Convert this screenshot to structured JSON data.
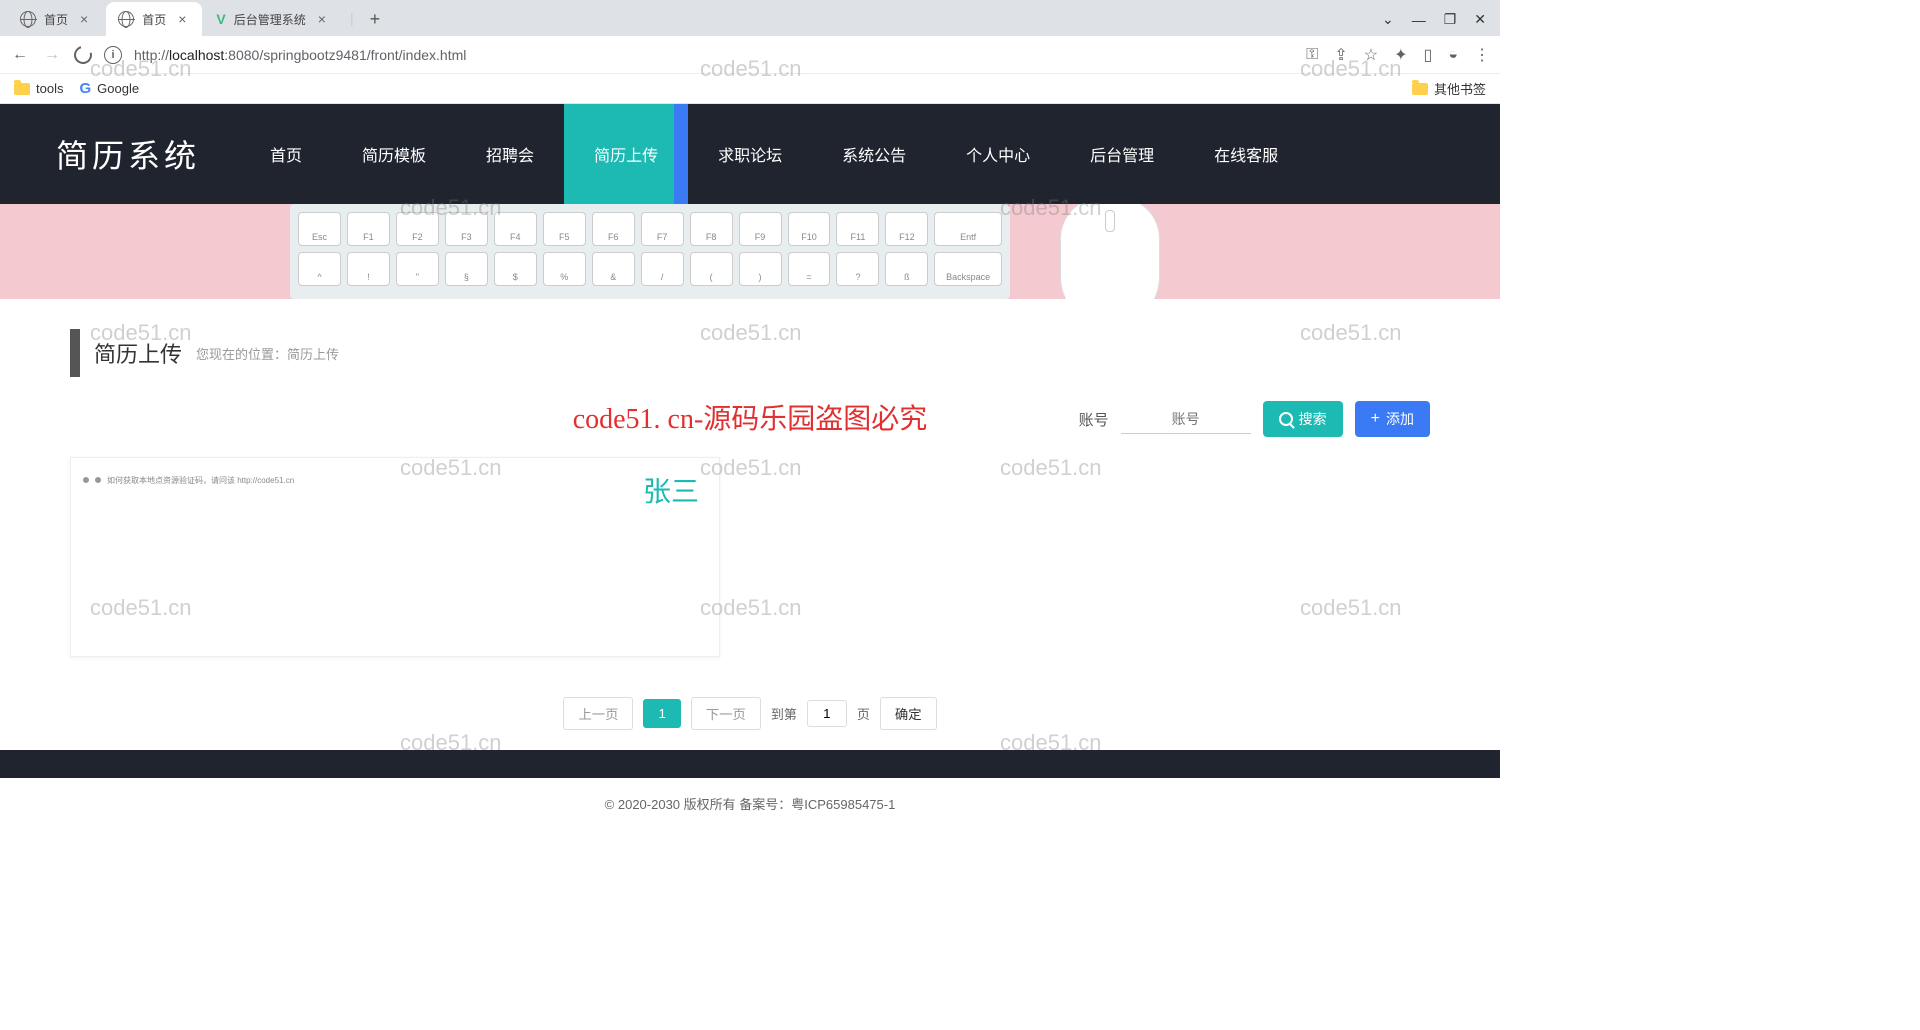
{
  "browser": {
    "tabs": [
      {
        "title": "首页",
        "icon": "globe"
      },
      {
        "title": "首页",
        "icon": "globe",
        "active": true
      },
      {
        "title": "后台管理系统",
        "icon": "vue"
      }
    ],
    "url_proto": "http://",
    "url_host": "localhost",
    "url_port": ":8080",
    "url_path": "/springbootz9481/front/index.html",
    "bookmarks": {
      "tools": "tools",
      "google": "Google",
      "other": "其他书签"
    }
  },
  "site": {
    "logo": "简历系统",
    "nav": [
      "首页",
      "简历模板",
      "招聘会",
      "简历上传",
      "求职论坛",
      "系统公告",
      "个人中心",
      "后台管理",
      "在线客服"
    ],
    "active_index": 3
  },
  "banner": {
    "keys_row1": [
      "Esc",
      "F1",
      "F2",
      "F3",
      "F4",
      "F5",
      "F6",
      "F7",
      "F8",
      "F9",
      "F10",
      "F11",
      "F12",
      "Entf"
    ],
    "keys_row2": [
      "^",
      "!",
      "\"",
      "§",
      "$",
      "%",
      "&",
      "/",
      "(",
      ")",
      "=",
      "?",
      "ß",
      "Backspace"
    ]
  },
  "breadcrumb": {
    "title": "简历上传",
    "prefix": "您现在的位置：",
    "current": "简历上传"
  },
  "watermark_center": "code51. cn-源码乐园盗图必究",
  "search": {
    "label": "账号",
    "placeholder": "账号",
    "search_btn": "搜索",
    "add_btn": "添加"
  },
  "cards": [
    {
      "name": "张三",
      "thumb_text": "如何获取本地点资源验证码，请问该 http://code51.cn"
    }
  ],
  "pager": {
    "prev": "上一页",
    "next": "下一页",
    "goto": "到第",
    "page": "1",
    "unit": "页",
    "confirm": "确定",
    "current": "1"
  },
  "footer": {
    "copy": "© 2020-2030 版权所有 备案号：粤ICP65985475-1"
  },
  "watermark_text": "code51.cn"
}
